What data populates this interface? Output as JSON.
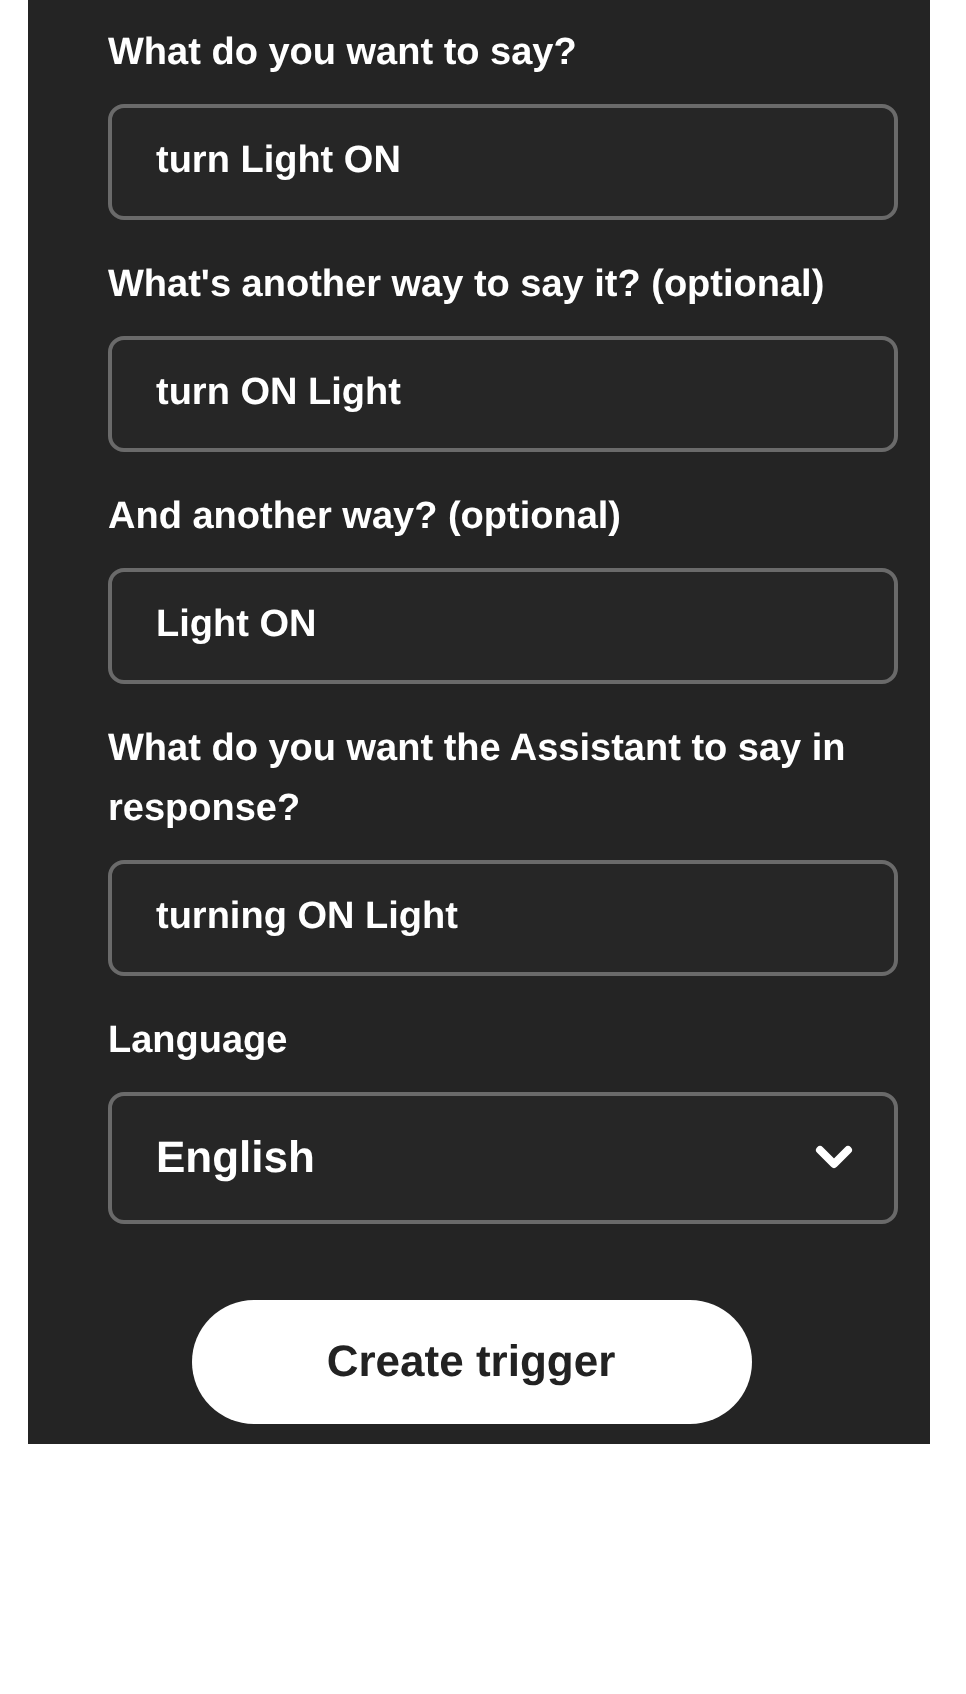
{
  "fields": [
    {
      "kind": "text",
      "label": "What do you want to say?",
      "value": "turn Light ON"
    },
    {
      "kind": "text",
      "label": "What's another way to say it? (optional)",
      "value": "turn ON Light"
    },
    {
      "kind": "text",
      "label": "And another way? (optional)",
      "value": "Light ON"
    },
    {
      "kind": "text",
      "label": "What do you want the Assistant to say in response?",
      "value": "turning ON Light"
    },
    {
      "kind": "select",
      "label": "Language",
      "value": "English"
    }
  ],
  "button": "Create trigger"
}
